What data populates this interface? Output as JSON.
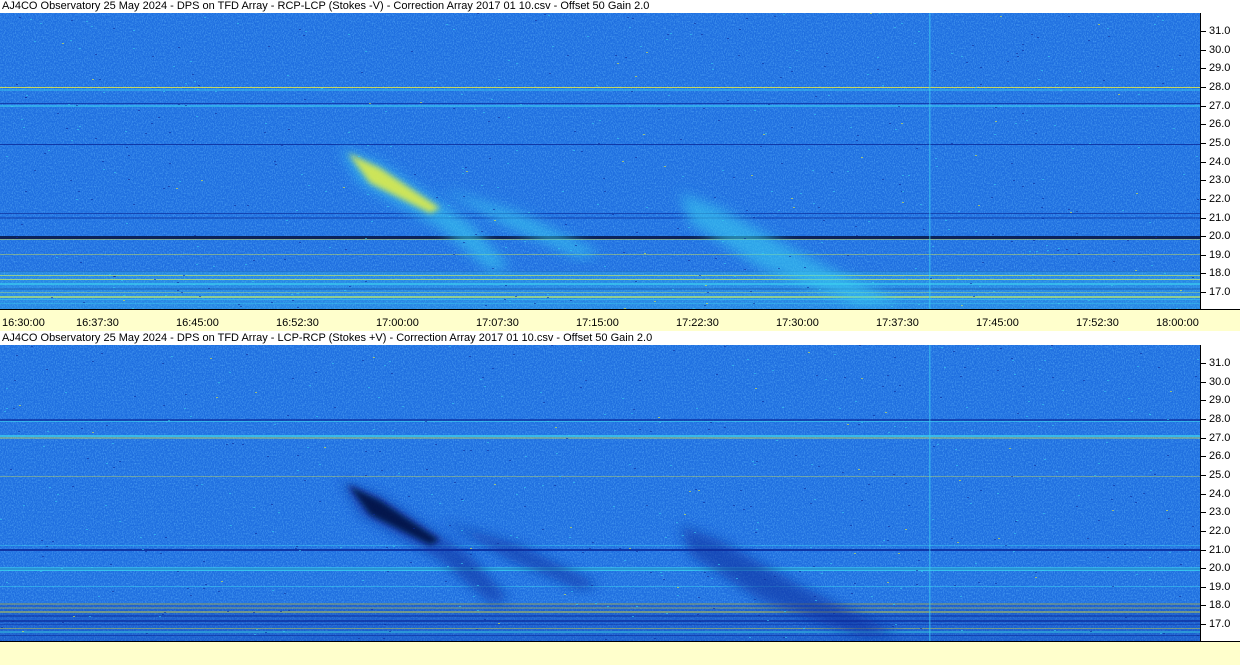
{
  "panels": [
    {
      "title": "AJ4CO Observatory 25 May 2024  -  DPS on TFD Array  -  RCP-LCP (Stokes -V)  -  Correction Array 2017 01 10.csv  -  Offset 50  Gain 2.0",
      "burst_style": "bright"
    },
    {
      "title": "AJ4CO Observatory 25 May 2024  -  DPS on TFD Array  -  LCP-RCP (Stokes +V)  -  Correction Array 2017 01 10.csv  -  Offset 50  Gain 2.0",
      "burst_style": "dark"
    }
  ],
  "freq_ticks": [
    "31.0",
    "30.0",
    "29.0",
    "28.0",
    "27.0",
    "26.0",
    "25.0",
    "24.0",
    "23.0",
    "22.0",
    "21.0",
    "20.0",
    "19.0",
    "18.0",
    "17.0"
  ],
  "time_ticks": [
    "16:30:00",
    "16:37:30",
    "16:45:00",
    "16:52:30",
    "17:00:00",
    "17:07:30",
    "17:15:00",
    "17:22:30",
    "17:30:00",
    "17:37:30",
    "17:45:00",
    "17:52:30",
    "18:00:00"
  ],
  "colors": {
    "background_blue": "#1f6fe0",
    "deep_blue": "#0a2a9a",
    "bright_cyan": "#3ad0f0",
    "yellow": "#e8f040",
    "axis_bg": "#ffffcc"
  }
}
